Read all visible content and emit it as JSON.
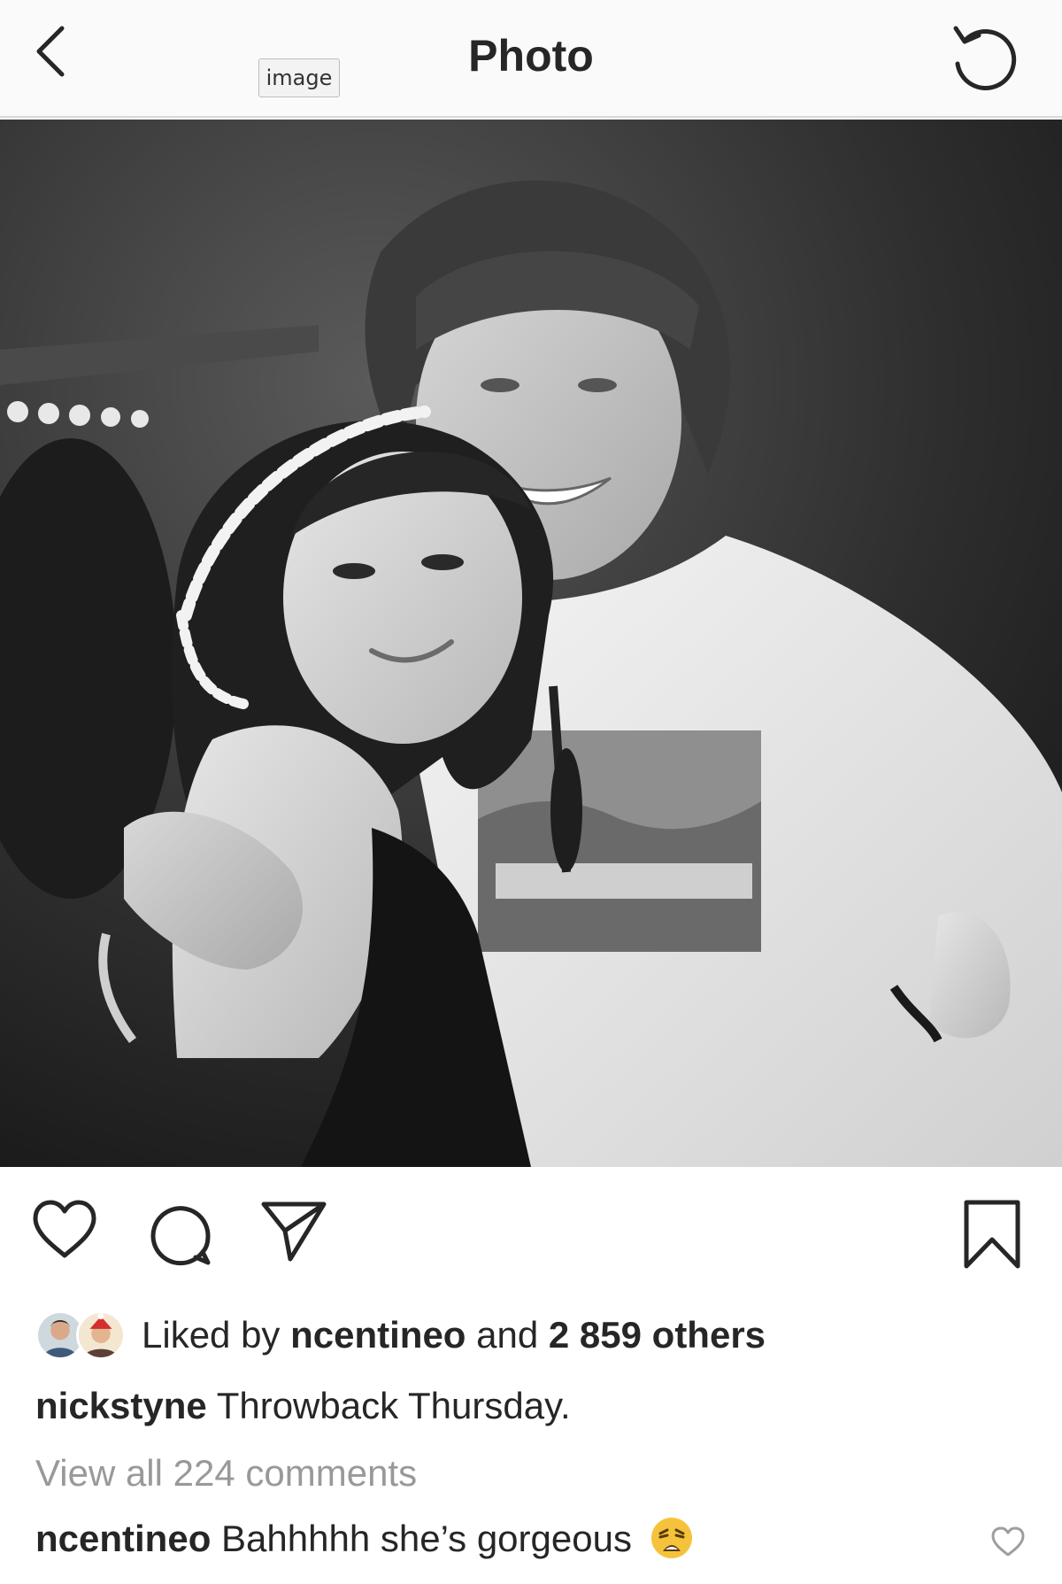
{
  "header": {
    "title": "Photo",
    "image_tag": "image",
    "back_icon": "chevron-left-icon",
    "refresh_icon": "refresh-icon"
  },
  "photo": {
    "style": "black-and-white"
  },
  "actions": {
    "like_icon": "heart-icon",
    "comment_icon": "comment-bubble-icon",
    "share_icon": "paper-plane-icon",
    "save_icon": "bookmark-icon"
  },
  "likes": {
    "prefix": "Liked by",
    "user": "ncentineo",
    "middle": "and",
    "others": "2 859 others"
  },
  "caption": {
    "username": "nickstyne",
    "text": "Throwback Thursday."
  },
  "view_all_comments": "View all 224 comments",
  "comments": [
    {
      "username": "ncentineo",
      "text": "Bahhhhh she’s gorgeous",
      "emoji": "weary-face-emoji"
    }
  ],
  "colors": {
    "text": "#262626",
    "muted": "#999999",
    "topbar_bg": "#fafafa",
    "emoji_yellow": "#f5c33b"
  }
}
